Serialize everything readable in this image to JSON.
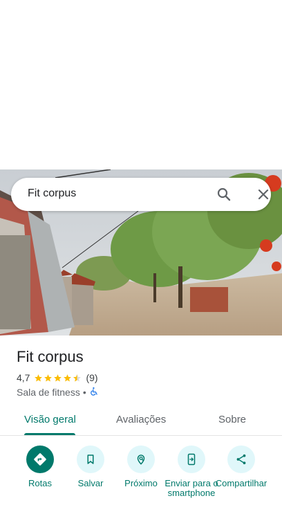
{
  "search": {
    "query": "Fit corpus"
  },
  "place": {
    "name": "Fit corpus",
    "rating": "4,7",
    "rating_stars": 4.5,
    "review_count": "(9)",
    "category": "Sala de fitness",
    "separator": "•"
  },
  "tabs": [
    {
      "label": "Visão geral",
      "active": true
    },
    {
      "label": "Avaliações",
      "active": false
    },
    {
      "label": "Sobre",
      "active": false
    }
  ],
  "actions": [
    {
      "label": "Rotas",
      "icon": "directions-icon"
    },
    {
      "label": "Salvar",
      "icon": "bookmark-icon"
    },
    {
      "label": "Próximo",
      "icon": "nearby-icon"
    },
    {
      "label": "Enviar para o smartphone",
      "icon": "send-to-phone-icon"
    },
    {
      "label": "Compartilhar",
      "icon": "share-icon"
    }
  ],
  "colors": {
    "accent": "#00796b",
    "accent_light": "#e0f7fa",
    "star": "#fbbc04",
    "accessibility": "#1a73e8"
  }
}
